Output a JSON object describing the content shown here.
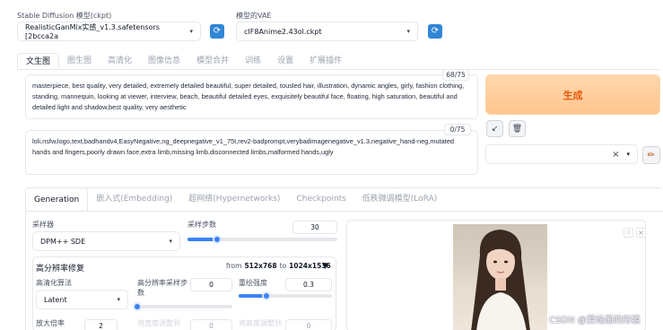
{
  "models": {
    "checkpoint_label": "Stable Diffusion 模型(ckpt)",
    "checkpoint_value": "RealisticGanMix实感_v1.3.safetensors [2bcca2a",
    "vae_label": "模型的VAE",
    "vae_value": "cIF8Anime2.43ol.ckpt"
  },
  "tabs": [
    "文生图",
    "图生图",
    "高清化",
    "图像信息",
    "模型合并",
    "训练",
    "设置",
    "扩展插件"
  ],
  "prompt": {
    "positive": "masterpiece, best quality, very detailed, extremely detailed beautiful, super detailed, tousled hair, illustration, dynamic angles, girly, fashion clothing, standing, mannequin, looking at viewer, interview, beach, beautiful detailed eyes, exquisitely beautiful face, floating, high saturation, beautiful and detailed light and shadow,best quality, very aesthetic",
    "positive_count": "68/75",
    "negative": "loli,nsfw,logo,text,badhandv4,EasyNegative,ng_deepnegative_v1_75t,rev2-badprompt,verybadimagenegative_v1.3,negative_hand-neg,mutated hands and fingers,poorly drawn face,extra limb,missing limb,disconnected limbs,malformed hands,ugly",
    "negative_count": "0/75"
  },
  "actions": {
    "generate": "生成",
    "arrow_icon": "↙",
    "trash_icon": "🗑",
    "pencil_icon": "✏",
    "clear_icon": "×",
    "caret": "▾"
  },
  "sub_tabs": [
    "Generation",
    "嵌入式(Embedding)",
    "超网络(Hypernetworks)",
    "Checkpoints",
    "低秩微调模型(LoRA)"
  ],
  "sampler": {
    "label": "采样器",
    "value": "DPM++ SDE",
    "steps_label": "采样步数",
    "steps_value": "30",
    "steps_level": 0.2
  },
  "hires": {
    "title": "高分辨率修复",
    "from_text": "from",
    "from_res": "512x768",
    "to_text": "to",
    "to_res": "1024x1536",
    "toggle": "▼",
    "upscaler_label": "高清化算法",
    "upscaler_value": "Latent",
    "steps_label": "高分辨率采样步数",
    "steps_value": "0",
    "steps_level": 0.0,
    "denoise_label": "重绘强度",
    "denoise_value": "0.3",
    "denoise_level": 0.3
  },
  "bottom": {
    "scale_label": "放大倍率",
    "scale_value": "2",
    "width_label": "将宽度调整到",
    "width_value": "0",
    "height_label": "将高度调整到",
    "height_value": "0"
  },
  "preview": {
    "star_icon": "☆",
    "close_icon": "×"
  },
  "watermark": "CSDN @爱绘画的彤姐",
  "colors": {
    "accent": "#3b82f6",
    "generate_bg": "#fec690",
    "generate_text": "#ea580c",
    "refresh": "#2f86d6"
  }
}
